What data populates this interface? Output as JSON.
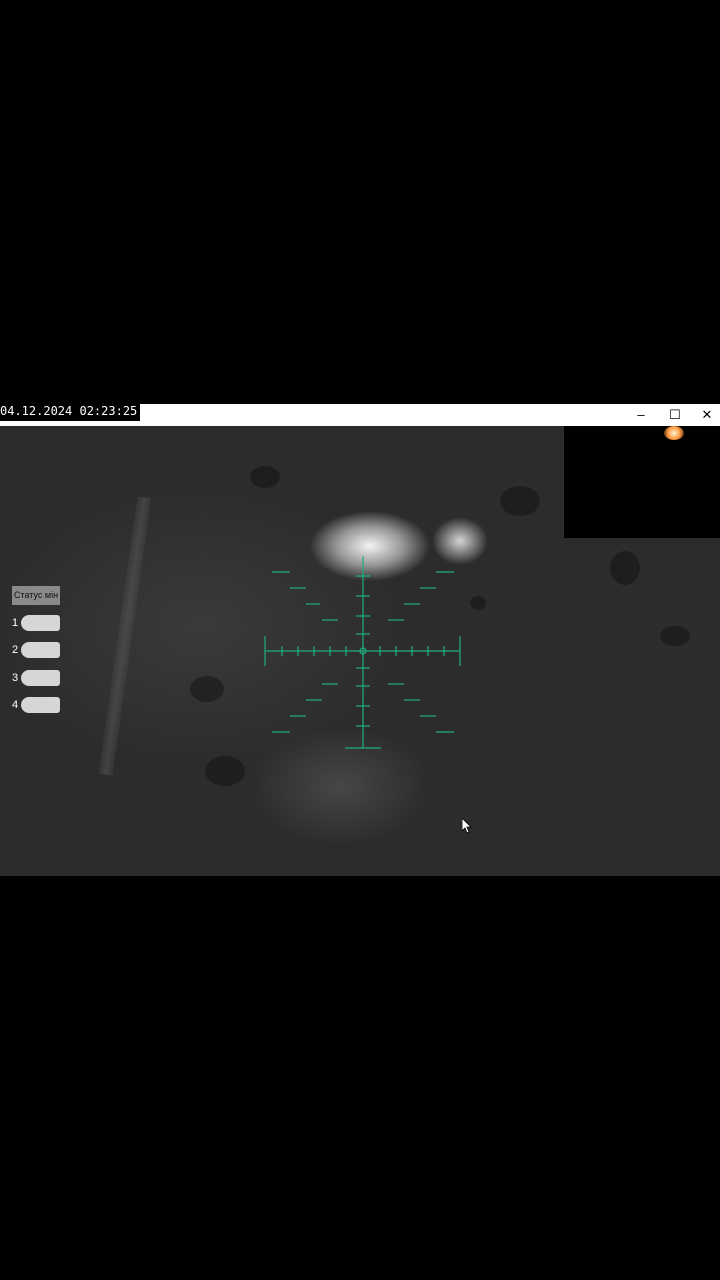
{
  "titlebar": {
    "timestamp": "04.12.2024 02:23:25",
    "minimize_label": "–",
    "maximize_label": "☐",
    "close_label": "✕"
  },
  "mine_status": {
    "label": "Статус мін",
    "mines": [
      {
        "number": "1",
        "icon": "mine-icon"
      },
      {
        "number": "2",
        "icon": "mine-icon"
      },
      {
        "number": "3",
        "icon": "mine-icon"
      },
      {
        "number": "4",
        "icon": "mine-icon"
      }
    ]
  },
  "reticle": {
    "color": "#1fae7a"
  },
  "colors": {
    "titlebar_bg": "#ffffff",
    "feed_bg": "#2a2a2a",
    "mine_fill": "#d6d6d6",
    "status_label_bg": "#8a8a8a"
  }
}
